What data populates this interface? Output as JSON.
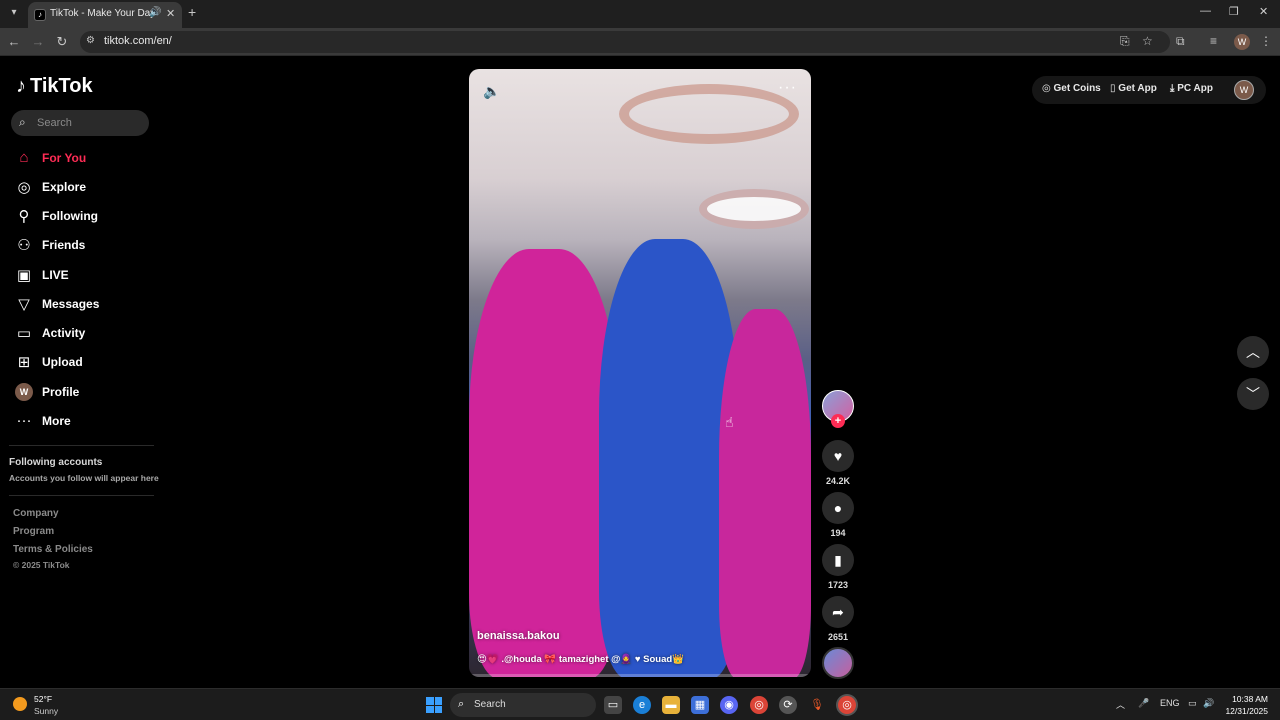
{
  "browser": {
    "tab_title": "TikTok - Make Your Day",
    "url": "tiktok.com/en/",
    "profile_initial": "W"
  },
  "sidebar": {
    "logo": "TikTok",
    "search_placeholder": "Search",
    "items": [
      {
        "label": "For You",
        "icon": "home-icon"
      },
      {
        "label": "Explore",
        "icon": "compass-icon"
      },
      {
        "label": "Following",
        "icon": "user-follow-icon"
      },
      {
        "label": "Friends",
        "icon": "friends-icon"
      },
      {
        "label": "LIVE",
        "icon": "live-icon"
      },
      {
        "label": "Messages",
        "icon": "send-icon"
      },
      {
        "label": "Activity",
        "icon": "activity-icon"
      },
      {
        "label": "Upload",
        "icon": "upload-icon"
      },
      {
        "label": "Profile",
        "icon": "avatar"
      },
      {
        "label": "More",
        "icon": "more-icon"
      }
    ],
    "profile_initial": "W",
    "following_accounts_title": "Following accounts",
    "following_accounts_subtitle": "Accounts you follow will appear here",
    "footer": {
      "company": "Company",
      "program": "Program",
      "terms": "Terms & Policies",
      "copyright": "© 2025 TikTok"
    }
  },
  "video": {
    "author": "benaissa.bakou",
    "caption": "😍💗 .@houda 🎀 tamazighet @🧕 ♥ Souad👑",
    "likes": "24.2K",
    "comments": "194",
    "bookmarks": "1723",
    "shares": "2651",
    "follow_label": "+"
  },
  "header": {
    "get_coins": "Get Coins",
    "get_app": "Get App",
    "pc_app": "PC App",
    "profile_initial": "W"
  },
  "taskbar": {
    "weather_temp": "52°F",
    "weather_cond": "Sunny",
    "search_placeholder": "Search",
    "lang": "ENG",
    "time": "10:38 AM",
    "date": "12/31/2025"
  }
}
